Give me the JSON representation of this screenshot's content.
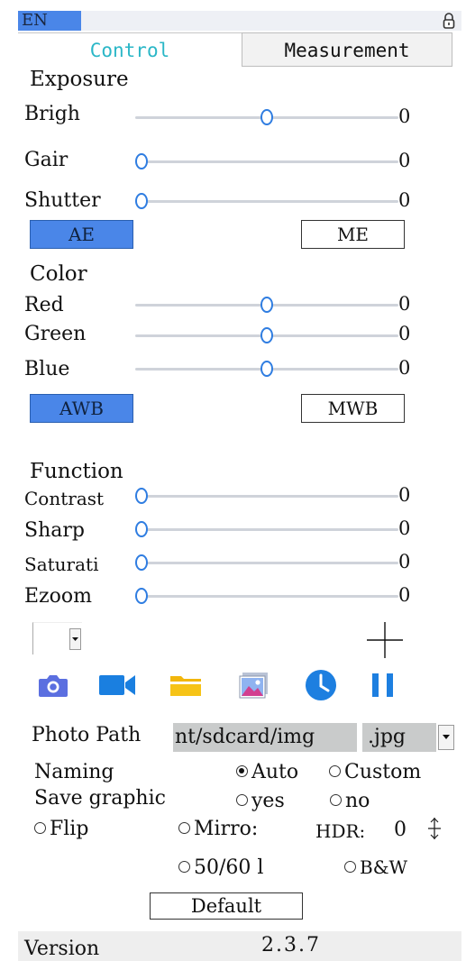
{
  "header": {
    "lang": "EN",
    "lock_icon": "lock-icon"
  },
  "tabs": [
    {
      "label": "Control",
      "active": true
    },
    {
      "label": "Measurement",
      "active": false
    }
  ],
  "exposure": {
    "title": "Exposure",
    "sliders": [
      {
        "label": "Brigh",
        "value": "0",
        "level": 0.5
      },
      {
        "label": "Gair",
        "value": "0",
        "level": 0.0
      },
      {
        "label": "Shutter",
        "value": "0",
        "level": 0.0
      }
    ],
    "ae_label": "AE",
    "me_label": "ME"
  },
  "color": {
    "title": "Color",
    "sliders": [
      {
        "label": "Red",
        "value": "0",
        "level": 0.5
      },
      {
        "label": "Green",
        "value": "0",
        "level": 0.5
      },
      {
        "label": "Blue",
        "value": "0",
        "level": 0.5
      }
    ],
    "awb_label": "AWB",
    "mwb_label": "MWB"
  },
  "function": {
    "title": "Function",
    "sliders": [
      {
        "label": "Contrast",
        "value": "0",
        "level": 0.0
      },
      {
        "label": "Sharp",
        "value": "0",
        "level": 0.0
      },
      {
        "label": "Saturati",
        "value": "0",
        "level": 0.0
      },
      {
        "label": "Ezoom",
        "value": "0",
        "level": 0.0
      }
    ]
  },
  "toolbar": {
    "icons": [
      "camera-icon",
      "video-icon",
      "folder-icon",
      "gallery-icon",
      "clock-icon",
      "pause-icon"
    ],
    "crosshair_icon": "crosshair-icon",
    "dropdown_value": ""
  },
  "settings": {
    "photo_path_label": "Photo Path",
    "photo_path_value": "nt/sdcard/img",
    "format_value": ".jpg",
    "naming_label": "Naming",
    "naming_auto": "Auto",
    "naming_custom": "Custom",
    "naming_selected": "Auto",
    "save_graphic_label": "Save graphic",
    "save_yes": "yes",
    "save_no": "no",
    "flip_label": "Flip",
    "mirror_label": "Mirro:",
    "hdr_label": "HDR:",
    "hdr_value": "0",
    "freq_label": "50/60 l",
    "bw_label": "B&W",
    "default_label": "Default"
  },
  "footer": {
    "version_label": "Version",
    "version_value": "2.3.7"
  },
  "colors": {
    "accent": "#4a86e8",
    "tab_active_text": "#2bb7c7",
    "slider_thumb": "#2f7de1"
  }
}
